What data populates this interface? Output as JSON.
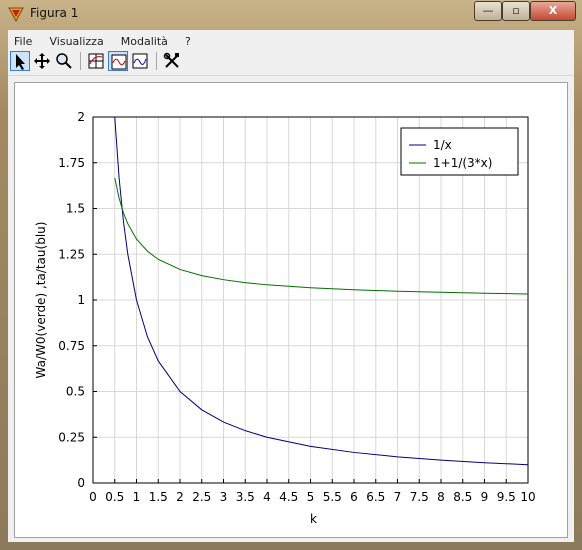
{
  "window": {
    "title": "Figura 1",
    "minimize_label": "—",
    "maximize_label": "▫",
    "close_label": "X"
  },
  "menu": [
    "File",
    "Visualizza",
    "Modalità",
    "?"
  ],
  "toolbar": [
    {
      "name": "select-tool",
      "icon": "arrow-icon",
      "selected": true
    },
    {
      "name": "pan-tool",
      "icon": "move-icon",
      "selected": false
    },
    {
      "name": "zoom-tool",
      "icon": "magnifier-icon",
      "selected": false
    },
    {
      "name": "grid-toggle",
      "icon": "grid-icon",
      "selected": false
    },
    {
      "name": "curve-toggle",
      "icon": "curve-icon",
      "selected": true
    },
    {
      "name": "axes-toggle",
      "icon": "axes-curve-icon",
      "selected": false
    },
    {
      "name": "properties-tool",
      "icon": "tools-icon",
      "selected": false
    }
  ],
  "chart_data": {
    "type": "line",
    "title": "",
    "xlabel": "k",
    "ylabel": "Wa/W0(verde) ,ta/tau(blu)",
    "xlim": [
      0,
      10
    ],
    "ylim": [
      0,
      2
    ],
    "xticks": [
      "0",
      "0.5",
      "1",
      "1.5",
      "2",
      "2.5",
      "3",
      "3.5",
      "4",
      "4.5",
      "5",
      "5.5",
      "6",
      "6.5",
      "7",
      "7.5",
      "8",
      "8.5",
      "9",
      "9.5",
      "10"
    ],
    "yticks": [
      "0",
      "0.25",
      "0.5",
      "0.75",
      "1",
      "1.25",
      "1.5",
      "1.75",
      "2"
    ],
    "grid": true,
    "legend_position": "top-right",
    "x": [
      0.5,
      0.6,
      0.7,
      0.8,
      1,
      1.25,
      1.5,
      2,
      2.5,
      3,
      3.5,
      4,
      5,
      6,
      7,
      8,
      9,
      10
    ],
    "series": [
      {
        "name": "1/x",
        "color": "#000080",
        "values": [
          2,
          1.667,
          1.429,
          1.25,
          1,
          0.8,
          0.667,
          0.5,
          0.4,
          0.333,
          0.286,
          0.25,
          0.2,
          0.167,
          0.143,
          0.125,
          0.111,
          0.1
        ]
      },
      {
        "name": "1+1/(3*x)",
        "color": "#007000",
        "values": [
          1.667,
          1.556,
          1.476,
          1.417,
          1.333,
          1.267,
          1.222,
          1.167,
          1.133,
          1.111,
          1.095,
          1.083,
          1.067,
          1.056,
          1.048,
          1.042,
          1.037,
          1.033
        ]
      }
    ]
  }
}
